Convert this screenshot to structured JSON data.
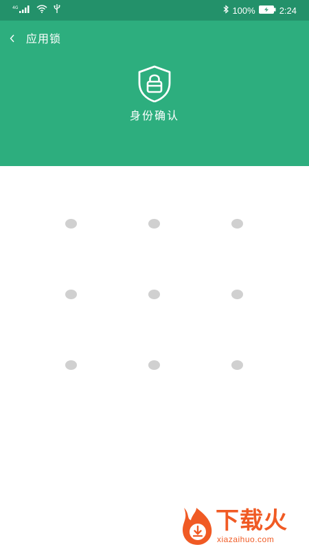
{
  "status_bar": {
    "network_type": "4G",
    "battery_percent": "100%",
    "time": "2:24",
    "icons": [
      "signal-icon",
      "wifi-icon",
      "usb-icon",
      "bluetooth-icon",
      "battery-charging-icon"
    ]
  },
  "header": {
    "back_icon": "chevron-left-icon",
    "title": "应用锁",
    "shield_icon": "shield-lock-icon",
    "subtitle": "身份确认"
  },
  "pattern": {
    "rows": 3,
    "cols": 3
  },
  "watermark": {
    "brand": "下载火",
    "url": "xiazaihuo.com"
  },
  "colors": {
    "status_bar": "#23916a",
    "header": "#2dae7e",
    "dot": "#d0d0d0",
    "watermark": "#f05a24"
  }
}
